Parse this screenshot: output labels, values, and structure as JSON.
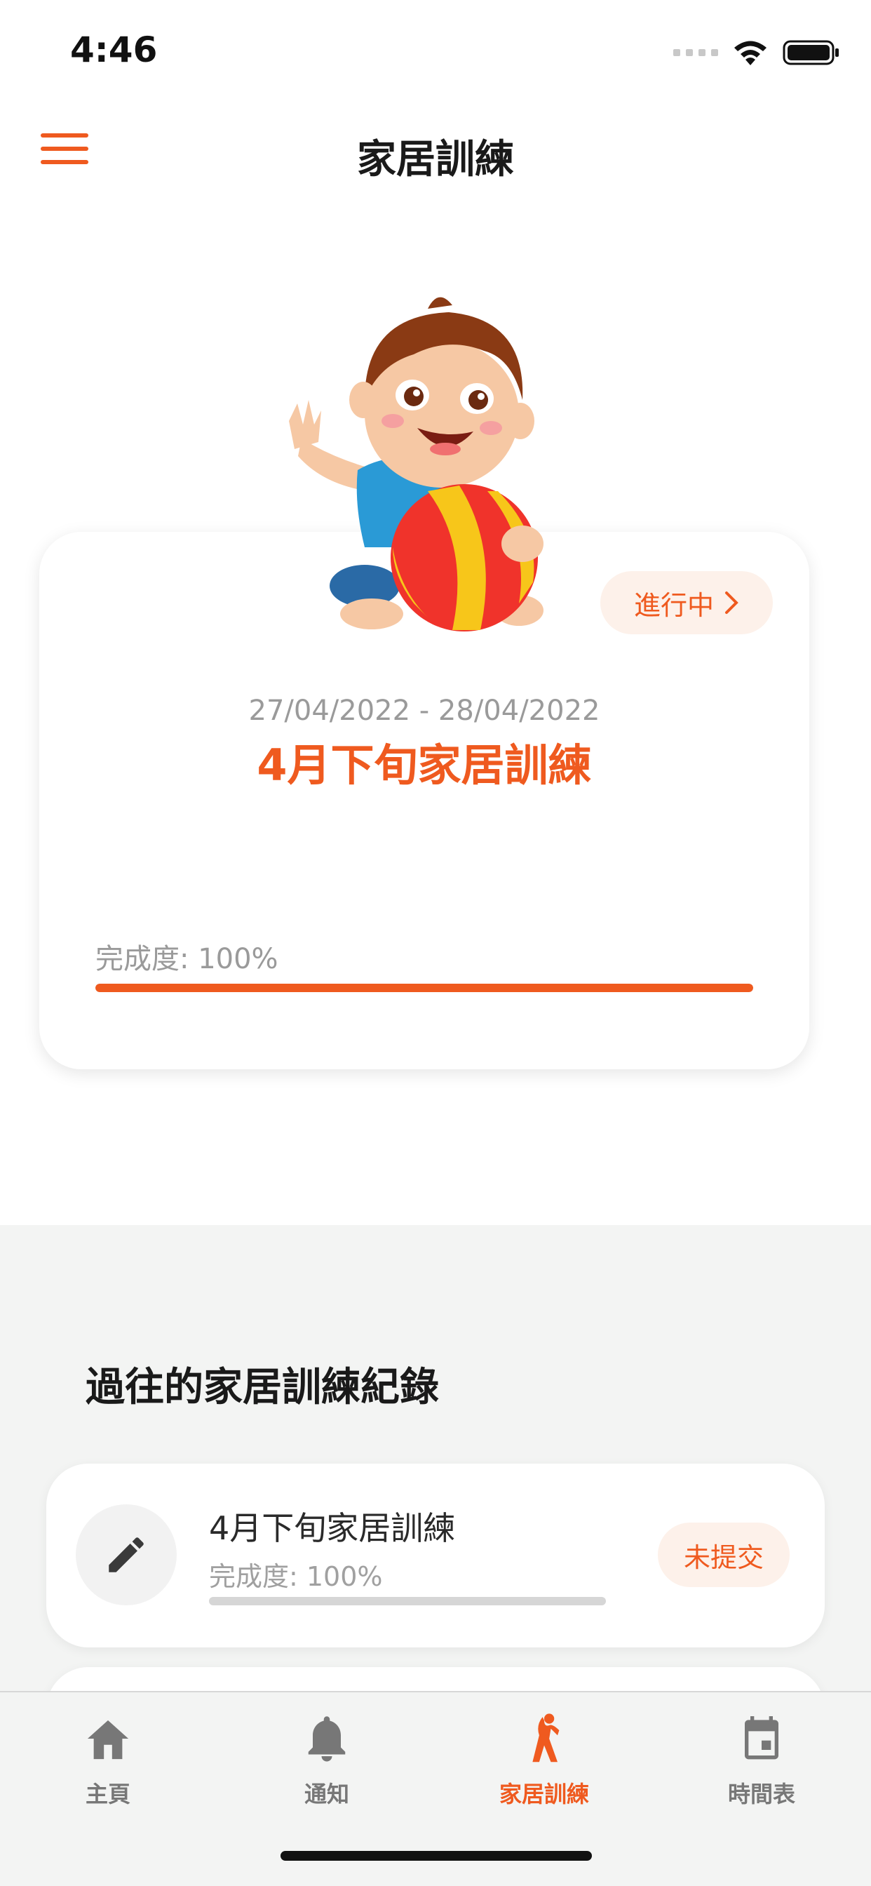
{
  "status_bar": {
    "time": "4:46"
  },
  "nav": {
    "title": "家居訓練",
    "menu_icon": "hamburger-icon"
  },
  "current": {
    "status": "進行中",
    "dates": "27/04/2022 - 28/04/2022",
    "title": "4月下旬家居訓練",
    "progress_label": "完成度: 100%",
    "progress": 1.0
  },
  "history": {
    "heading": "過往的家居訓練紀錄",
    "items": [
      {
        "title": "4月下旬家居訓練",
        "progress_label": "完成度: 100%",
        "status": "未提交",
        "icon": "pencil-icon"
      }
    ]
  },
  "tabs": [
    {
      "label": "主頁",
      "icon": "home-icon",
      "active": false
    },
    {
      "label": "通知",
      "icon": "bell-icon",
      "active": false
    },
    {
      "label": "家居訓練",
      "icon": "exercise-icon",
      "active": true
    },
    {
      "label": "時間表",
      "icon": "calendar-icon",
      "active": false
    }
  ],
  "colors": {
    "accent": "#ef5a1f",
    "pill_bg": "#fdf1ea",
    "section_bg": "#f3f4f3"
  }
}
